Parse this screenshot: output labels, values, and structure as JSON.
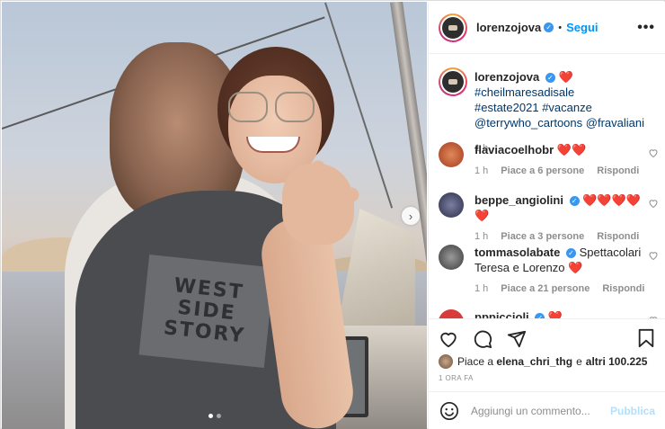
{
  "post": {
    "author": "lorenzojova",
    "follow_label": "Segui",
    "separator": "•",
    "more_label": "•••",
    "verified_mark": "✓",
    "next_arrow": "›",
    "shirt_lines": [
      "WEST",
      "SIDE",
      "STORY"
    ],
    "caption": {
      "username": "lorenzojova",
      "heart": "❤️",
      "tags": [
        "#cheilmaresadisale",
        "#estate2021",
        "#vacanze"
      ],
      "mentions": [
        "@terrywho_cartoons",
        "@fravaliani"
      ],
      "time": "1 h"
    },
    "comments": [
      {
        "username": "flaviacoelhobr",
        "text": "❤️❤️",
        "time": "1 h",
        "likes": "Piace a 6 persone",
        "reply": "Rispondi",
        "verified": false,
        "avatar_color": "#c7542e"
      },
      {
        "username": "beppe_angiolini",
        "text": "❤️❤️❤️❤️❤️",
        "time": "1 h",
        "likes": "Piace a 3 persone",
        "reply": "Rispondi",
        "verified": true,
        "avatar_color": "#3b3f5c"
      },
      {
        "username": "tommasolabate",
        "text": "Spettacolari Teresa e Lorenzo ❤️",
        "time": "1 h",
        "likes": "Piace a 21 persone",
        "reply": "Rispondi",
        "verified": true,
        "avatar_color": "#5a5a5a"
      },
      {
        "username": "pppiccioli",
        "text": "❤️",
        "time": "",
        "likes": "",
        "reply": "",
        "verified": true,
        "avatar_color": "#d93a3a"
      }
    ],
    "liked_by": {
      "prefix": "Piace a",
      "user": "elena_chri_thg",
      "conj": "e",
      "others": "altri 100.225"
    },
    "post_time": "1 ORA FA",
    "add_comment": {
      "placeholder": "Aggiungi un commento...",
      "publish_label": "Pubblica"
    }
  },
  "colors": {
    "link": "#00376b",
    "follow": "#0095f6",
    "heart": "#e0245e",
    "publish_disabled": "#b2dffc"
  }
}
